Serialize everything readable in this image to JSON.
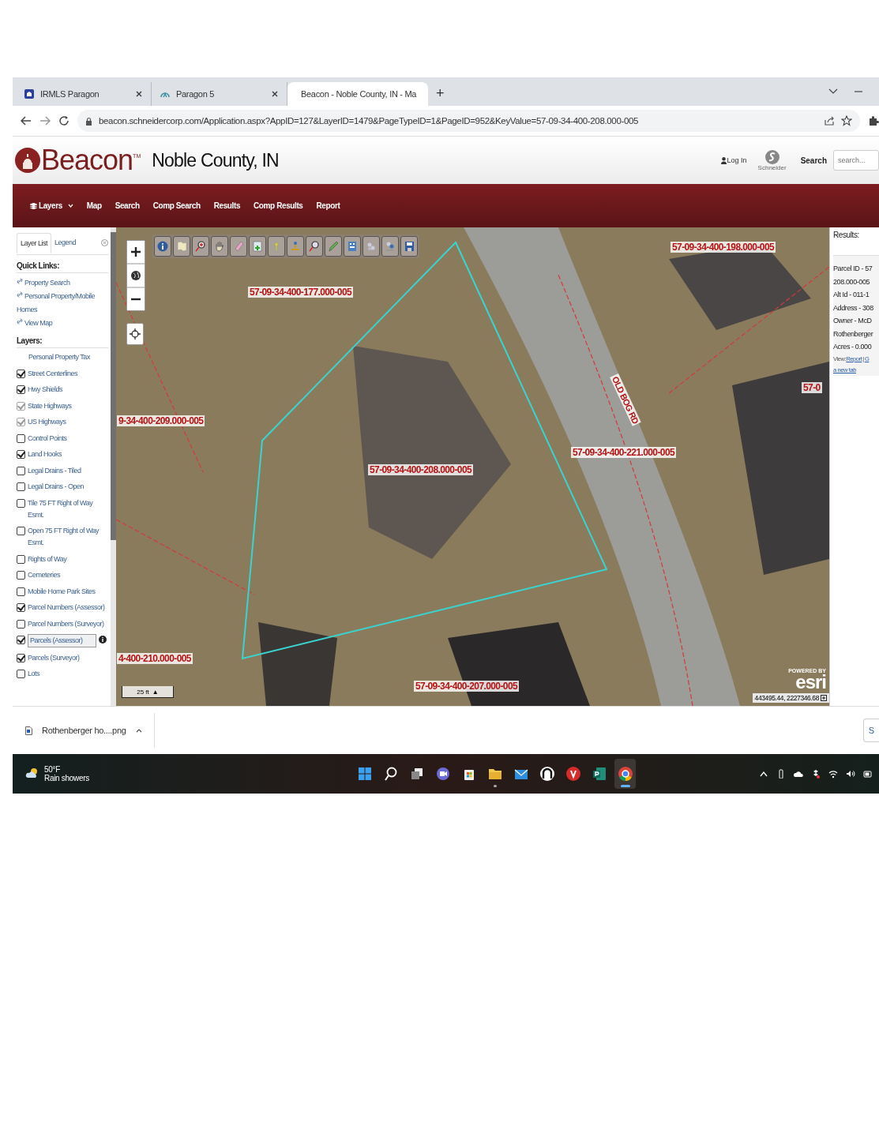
{
  "browser": {
    "tabs": [
      {
        "title": "IRMLS Paragon",
        "selected": false,
        "kind": "house"
      },
      {
        "title": "Paragon 5",
        "selected": false,
        "kind": "arc"
      },
      {
        "title": "Beacon - Noble County, IN - Ma",
        "selected": true,
        "kind": "beacon"
      }
    ],
    "new_tab": "+",
    "url": "beacon.schneidercorp.com/Application.aspx?AppID=127&LayerID=1479&PageTypeID=1&PageID=952&KeyValue=57-09-34-400-208.000-005"
  },
  "header": {
    "logo": "Beacon",
    "trademark": "TM",
    "county": "Noble County, IN",
    "login": "Log In",
    "partner": "Schneider",
    "search_label": "Search",
    "search_placeholder": "search..."
  },
  "nav": [
    {
      "label": "Layers",
      "kind": "dropdown"
    },
    {
      "label": "Map",
      "kind": "link"
    },
    {
      "label": "Search",
      "kind": "link"
    },
    {
      "label": "Comp Search",
      "kind": "link"
    },
    {
      "label": "Results",
      "kind": "link"
    },
    {
      "label": "Comp Results",
      "kind": "link"
    },
    {
      "label": "Report",
      "kind": "link"
    }
  ],
  "sidebar": {
    "tabs": [
      {
        "label": "Layer List",
        "selected": true
      },
      {
        "label": "Legend",
        "selected": false
      }
    ],
    "quick_links_title": "Quick Links:",
    "quick_links": [
      "Property Search",
      "Personal Property/Mobile Homes",
      "View Map"
    ],
    "layers_title": "Layers:",
    "layers": [
      {
        "label": "Personal Property Tax",
        "kind": "group",
        "selected": false
      },
      {
        "label": "Street Centerlines",
        "kind": "layer",
        "checked": true,
        "disabled": false,
        "selected": false
      },
      {
        "label": "Hwy Shields",
        "kind": "layer",
        "checked": true,
        "disabled": false,
        "selected": false
      },
      {
        "label": "State Highways",
        "kind": "layer",
        "checked": true,
        "disabled": true,
        "selected": false
      },
      {
        "label": "US Highways",
        "kind": "layer",
        "checked": true,
        "disabled": true,
        "selected": false
      },
      {
        "label": "Control Points",
        "kind": "layer",
        "checked": false,
        "disabled": false,
        "selected": false
      },
      {
        "label": "Land Hooks",
        "kind": "layer",
        "checked": true,
        "disabled": false,
        "selected": false
      },
      {
        "label": "Legal Drains - Tiled",
        "kind": "layer",
        "checked": false,
        "disabled": false,
        "selected": false
      },
      {
        "label": "Legal Drains - Open",
        "kind": "layer",
        "checked": false,
        "disabled": false,
        "selected": false
      },
      {
        "label": "Tile 75 FT Right of Way Esmt.",
        "kind": "layer",
        "checked": false,
        "disabled": false,
        "selected": false
      },
      {
        "label": "Open 75 FT Right of Way Esmt.",
        "kind": "layer",
        "checked": false,
        "disabled": false,
        "selected": false
      },
      {
        "label": "Rights of Way",
        "kind": "layer",
        "checked": false,
        "disabled": false,
        "selected": false
      },
      {
        "label": "Cemeteries",
        "kind": "layer",
        "checked": false,
        "disabled": false,
        "selected": false
      },
      {
        "label": "Mobile Home Park Sites",
        "kind": "layer",
        "checked": false,
        "disabled": false,
        "selected": false
      },
      {
        "label": "Parcel Numbers (Assessor)",
        "kind": "layer",
        "checked": true,
        "disabled": false,
        "selected": false
      },
      {
        "label": "Parcel Numbers (Surveyor)",
        "kind": "layer",
        "checked": false,
        "disabled": false,
        "selected": false
      },
      {
        "label": "Parcels (Assessor)",
        "kind": "layer",
        "checked": true,
        "disabled": false,
        "selected": true
      },
      {
        "label": "Parcels (Surveyor)",
        "kind": "layer",
        "checked": true,
        "disabled": false,
        "selected": false
      },
      {
        "label": "Lots",
        "kind": "layer",
        "checked": false,
        "disabled": false,
        "selected": false
      }
    ]
  },
  "map": {
    "labels": [
      {
        "text": "57-09-34-400-177.000-005",
        "kind": "parcel"
      },
      {
        "text": "57-09-34-400-198.000-005",
        "kind": "parcel"
      },
      {
        "text": "9-34-400-209.000-005",
        "kind": "parcel"
      },
      {
        "text": "57-09-34-400-208.000-005",
        "kind": "parcel"
      },
      {
        "text": "57-09-34-400-221.000-005",
        "kind": "parcel"
      },
      {
        "text": "OLD BOG RD",
        "kind": "road"
      },
      {
        "text": "4-400-210.000-005",
        "kind": "parcel"
      },
      {
        "text": "57-09-34-400-207.000-005",
        "kind": "parcel"
      },
      {
        "text": "57-0",
        "kind": "parcel"
      }
    ],
    "scale": "25 ft",
    "scale_toggle": "▲",
    "coordinates": "443495.44, 2227346.68",
    "esri_powered": "POWERED BY",
    "esri": "esri"
  },
  "results": {
    "title": "Results:",
    "lines": [
      {
        "text": "Parcel ID - 57",
        "kind": "text"
      },
      {
        "text": "208.000-005",
        "kind": "text"
      },
      {
        "text": "Alt Id - 011-1",
        "kind": "text"
      },
      {
        "text": "Address - 308",
        "kind": "text"
      },
      {
        "text": "Owner - McD",
        "kind": "text"
      },
      {
        "text": "Rothenberger",
        "kind": "text"
      },
      {
        "text": "Acres - 0.000",
        "kind": "text"
      },
      {
        "text": "View:",
        "kind": "view"
      },
      {
        "text": "a new tab",
        "kind": "link"
      }
    ],
    "view_links": [
      "Report",
      "G"
    ],
    "view_separator": "|"
  },
  "downloads": {
    "file": "Rothenberger ho....png",
    "show_all": "S"
  },
  "taskbar": {
    "weather": {
      "temp": "50°F",
      "desc": "Rain showers"
    },
    "apps": [
      {
        "kind": "start",
        "running": false,
        "active": false
      },
      {
        "kind": "search",
        "running": false,
        "active": false
      },
      {
        "kind": "taskview",
        "running": false,
        "active": false
      },
      {
        "kind": "chat",
        "running": false,
        "active": false
      },
      {
        "kind": "store",
        "running": false,
        "active": false
      },
      {
        "kind": "folder",
        "running": true,
        "active": false
      },
      {
        "kind": "mail",
        "running": false,
        "active": false
      },
      {
        "kind": "arch",
        "running": false,
        "active": false
      },
      {
        "kind": "vpn",
        "running": false,
        "active": false
      },
      {
        "kind": "publisher",
        "running": false,
        "active": false
      },
      {
        "kind": "chrome",
        "running": true,
        "active": true
      }
    ]
  }
}
